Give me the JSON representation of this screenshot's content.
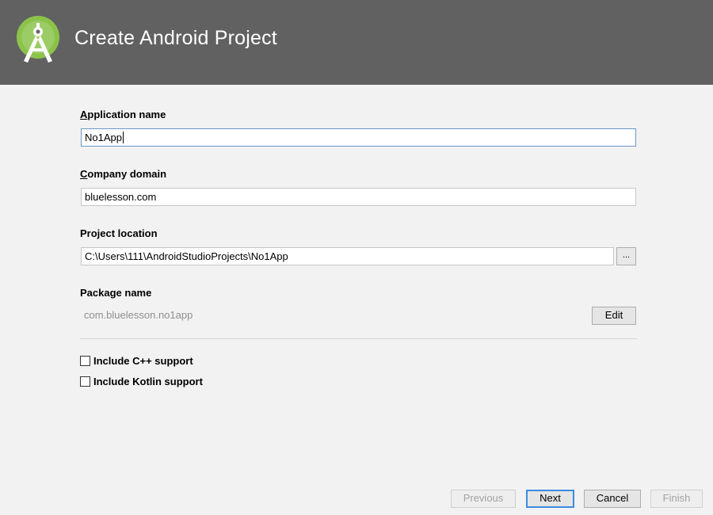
{
  "window": {
    "title": "Create Android Project",
    "logo_icon": "android-studio-logo-icon",
    "colors": {
      "header_background": "#616161",
      "body_background": "#f2f2f2",
      "focus_border": "#3c8ce0"
    }
  },
  "form": {
    "application_name": {
      "label_mnemonic": "A",
      "label_rest": "pplication name",
      "value": "No1App"
    },
    "company_domain": {
      "label_mnemonic": "C",
      "label_rest": "ompany domain",
      "value": "bluelesson.com"
    },
    "project_location": {
      "label": "Project location",
      "value": "C:\\Users\\111\\AndroidStudioProjects\\No1App",
      "browse_label": "..."
    },
    "package_name": {
      "label": "Package name",
      "value": "com.bluelesson.no1app",
      "edit_label": "Edit"
    },
    "options": [
      {
        "label": "Include C++ support",
        "checked": false
      },
      {
        "label": "Include Kotlin support",
        "checked": false
      }
    ]
  },
  "footer": {
    "previous_label": "Previous",
    "next_label": "Next",
    "cancel_label": "Cancel",
    "finish_label": "Finish"
  }
}
